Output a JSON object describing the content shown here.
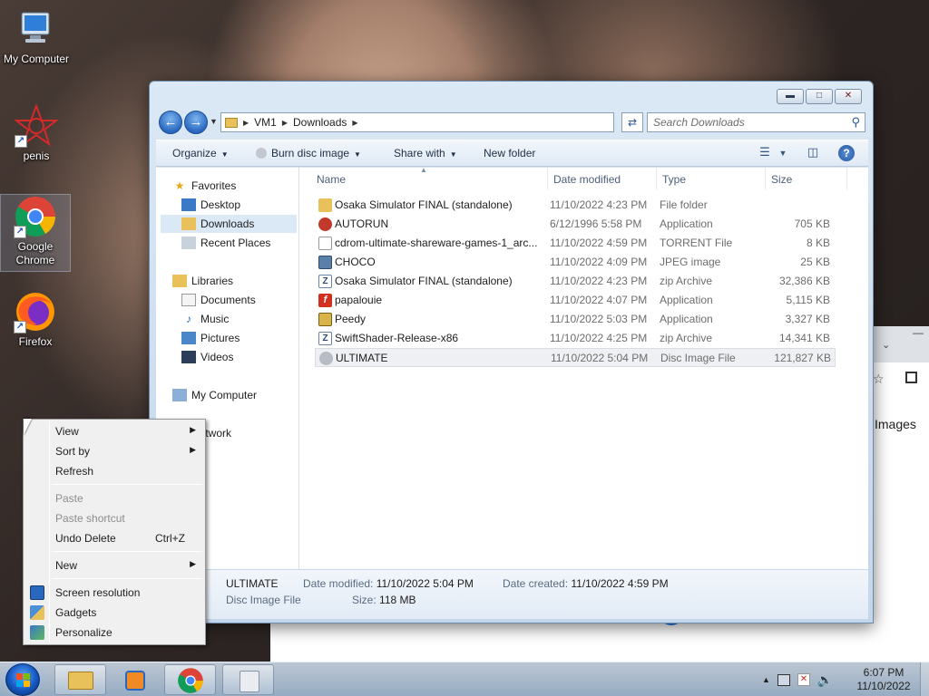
{
  "desktop": {
    "icons": [
      {
        "label": "My Computer",
        "icon": "computer-icon"
      },
      {
        "label": "penis",
        "icon": "red-star-shortcut-icon"
      },
      {
        "label": "Google Chrome",
        "icon": "chrome-icon"
      },
      {
        "label": "Firefox",
        "icon": "firefox-icon"
      }
    ]
  },
  "browser_behind": {
    "images_link": "Images"
  },
  "explorer": {
    "breadcrumb": [
      "VM1",
      "Downloads"
    ],
    "search_placeholder": "Search Downloads",
    "caption_buttons": [
      "minimize",
      "maximize",
      "close"
    ],
    "toolbar": {
      "organize": "Organize",
      "burn": "Burn disc image",
      "share": "Share with",
      "new_folder": "New folder"
    },
    "nav_pane": {
      "favorites": "Favorites",
      "desktop": "Desktop",
      "downloads": "Downloads",
      "recent": "Recent Places",
      "libraries": "Libraries",
      "documents": "Documents",
      "music": "Music",
      "pictures": "Pictures",
      "videos": "Videos",
      "my_computer": "My Computer",
      "network": "Network"
    },
    "columns": {
      "name": "Name",
      "date": "Date modified",
      "type": "Type",
      "size": "Size"
    },
    "files": [
      {
        "name": "Osaka Simulator FINAL (standalone)",
        "date": "11/10/2022 4:23 PM",
        "type": "File folder",
        "size": "",
        "icon": "folder-icon",
        "color": "#e8c15a"
      },
      {
        "name": "AUTORUN",
        "date": "6/12/1996 5:58 PM",
        "type": "Application",
        "size": "705 KB",
        "icon": "autorun-icon",
        "color": "#c0392b"
      },
      {
        "name": "cdrom-ultimate-shareware-games-1_arc...",
        "date": "11/10/2022 4:59 PM",
        "type": "TORRENT File",
        "size": "8 KB",
        "icon": "blank-file-icon",
        "color": "#ffffff"
      },
      {
        "name": "CHOCO",
        "date": "11/10/2022 4:09 PM",
        "type": "JPEG image",
        "size": "25 KB",
        "icon": "image-file-icon",
        "color": "#5a7fa8"
      },
      {
        "name": "Osaka Simulator FINAL (standalone)",
        "date": "11/10/2022 4:23 PM",
        "type": "zip Archive",
        "size": "32,386 KB",
        "icon": "zip-icon",
        "color": "#6c84a8"
      },
      {
        "name": "papalouie",
        "date": "11/10/2022 4:07 PM",
        "type": "Application",
        "size": "5,115 KB",
        "icon": "flash-icon",
        "color": "#d32f1e"
      },
      {
        "name": "Peedy",
        "date": "11/10/2022 5:03 PM",
        "type": "Application",
        "size": "3,327 KB",
        "icon": "peedy-icon",
        "color": "#d9b44a"
      },
      {
        "name": "SwiftShader-Release-x86",
        "date": "11/10/2022 4:25 PM",
        "type": "zip Archive",
        "size": "14,341 KB",
        "icon": "zip-icon",
        "color": "#6c84a8"
      },
      {
        "name": "ULTIMATE",
        "date": "11/10/2022 5:04 PM",
        "type": "Disc Image File",
        "size": "121,827 KB",
        "icon": "disc-image-icon",
        "color": "#b8bcc4"
      }
    ],
    "details": {
      "name": "ULTIMATE",
      "type": "Disc Image File",
      "modified_label": "Date modified:",
      "modified_value": "11/10/2022 5:04 PM",
      "created_label": "Date created:",
      "created_value": "11/10/2022 4:59 PM",
      "size_label": "Size:",
      "size_value": "118 MB"
    }
  },
  "context_menu": {
    "view": "View",
    "sort_by": "Sort by",
    "refresh": "Refresh",
    "paste": "Paste",
    "paste_shortcut": "Paste shortcut",
    "undo_delete": "Undo Delete",
    "undo_shortcut": "Ctrl+Z",
    "new": "New",
    "screen_resolution": "Screen resolution",
    "gadgets": "Gadgets",
    "personalize": "Personalize"
  },
  "taskbar": {
    "pinned": [
      "windows-explorer-icon",
      "media-player-icon",
      "chrome-icon",
      "disc-image-taskbar-icon"
    ],
    "time": "6:07 PM",
    "date": "11/10/2022"
  },
  "colors": {
    "accent": "#2a68c0",
    "selection": "#dbe8f6"
  }
}
